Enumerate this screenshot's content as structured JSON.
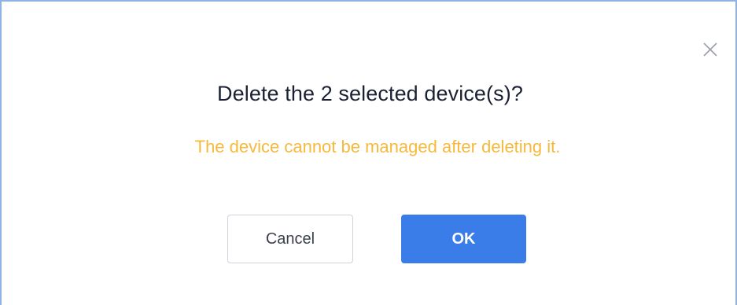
{
  "dialog": {
    "title": "Delete the 2 selected device(s)?",
    "warning": "The device cannot be managed after deleting it.",
    "close_icon": "close-icon",
    "buttons": {
      "cancel_label": "Cancel",
      "ok_label": "OK"
    }
  },
  "colors": {
    "title": "#1b2033",
    "warning": "#f6b93b",
    "primary": "#3b7de8",
    "frame_border": "#8fb4e3"
  }
}
